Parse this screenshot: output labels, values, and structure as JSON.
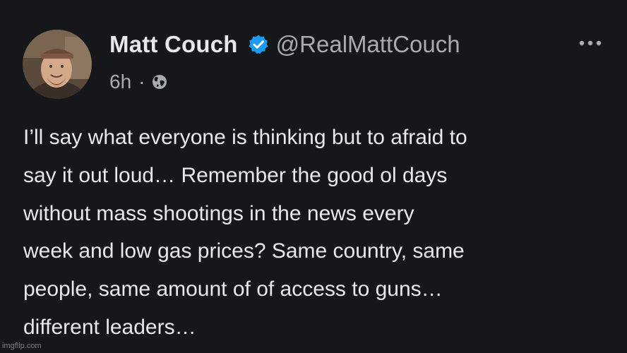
{
  "post": {
    "display_name": "Matt Couch",
    "handle": "@RealMattCouch",
    "timestamp": "6h",
    "separator": "·",
    "visibility_icon": "globe-icon",
    "verified_icon": "verified-badge-icon",
    "more_icon": "more-options-icon",
    "text_lines": [
      "I’ll say what everyone is thinking but to afraid to",
      "say it out loud… Remember the good ol days",
      "without mass shootings in the news every",
      "week and low gas prices? Same country, same",
      "people, same amount of of access to guns…",
      "different leaders…"
    ]
  },
  "watermark": "imgflip.com",
  "colors": {
    "background": "#15171b",
    "text_primary": "#e7e9ea",
    "text_secondary": "#a7acb1",
    "verified_badge": "#1d9bf0"
  }
}
